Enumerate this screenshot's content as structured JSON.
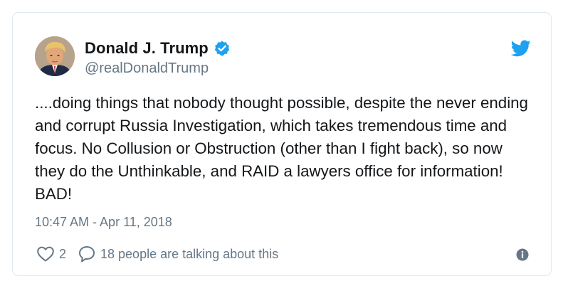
{
  "tweet": {
    "author_name": "Donald J. Trump",
    "handle": "@realDonaldTrump",
    "text": "....doing things that nobody thought possible, despite the never ending and corrupt Russia Investigation, which takes tremendous time and focus. No Collusion or Obstruction (other than I fight back), so now they do the Unthinkable, and RAID a lawyers office for information! BAD!",
    "timestamp": "10:47 AM - Apr 11, 2018",
    "likes": "2",
    "conversation": "18 people are talking about this"
  },
  "icons": {
    "verified": "verified-badge-icon",
    "brand": "twitter-bird-icon",
    "like": "heart-icon",
    "reply": "speech-bubble-icon",
    "info": "info-icon"
  },
  "colors": {
    "accent": "#1da1f2",
    "text": "#14171a",
    "muted": "#657786",
    "border": "#e1e8ed"
  }
}
